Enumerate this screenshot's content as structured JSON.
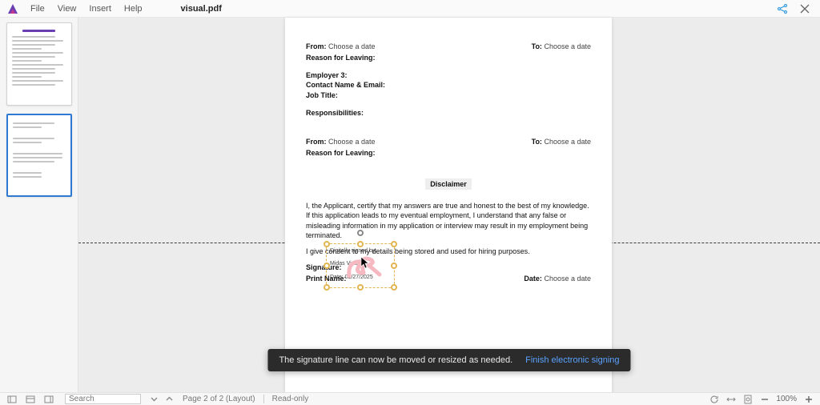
{
  "menu": {
    "file": "File",
    "view": "View",
    "insert": "Insert",
    "help": "Help"
  },
  "docTitle": "visual.pdf",
  "page": {
    "from": "From:",
    "to": "To:",
    "choose": "Choose a date",
    "reasonLeaving": "Reason for Leaving:",
    "employer3": "Employer 3:",
    "contact": "Contact Name & Email:",
    "jobTitle": "Job Title:",
    "responsibilities": "Responsibilities:",
    "disclaimer": "Disclaimer",
    "certifyPara": "I, the Applicant, certify that my answers are true and honest to the best of my knowledge. If this application leads to my eventual employment, I understand that any false or misleading information in my application or interview may result in my employment being terminated.",
    "consentPara": "I give consent to my details being stored and used for hiring purposes.",
    "signature": "Signature:",
    "printName": "Print Name:",
    "date": "Date:"
  },
  "sig": {
    "digitallySigned": "Digitally signed by:",
    "name": "Midas Vipia",
    "dateLine": "Date: 02/27/2025"
  },
  "toast": {
    "msg": "The signature line can now be moved or resized as needed.",
    "action": "Finish electronic signing"
  },
  "status": {
    "searchPlaceholder": "Search",
    "page": "Page 2 of 2 (Layout)",
    "readonly": "Read-only",
    "zoom": "100%"
  }
}
